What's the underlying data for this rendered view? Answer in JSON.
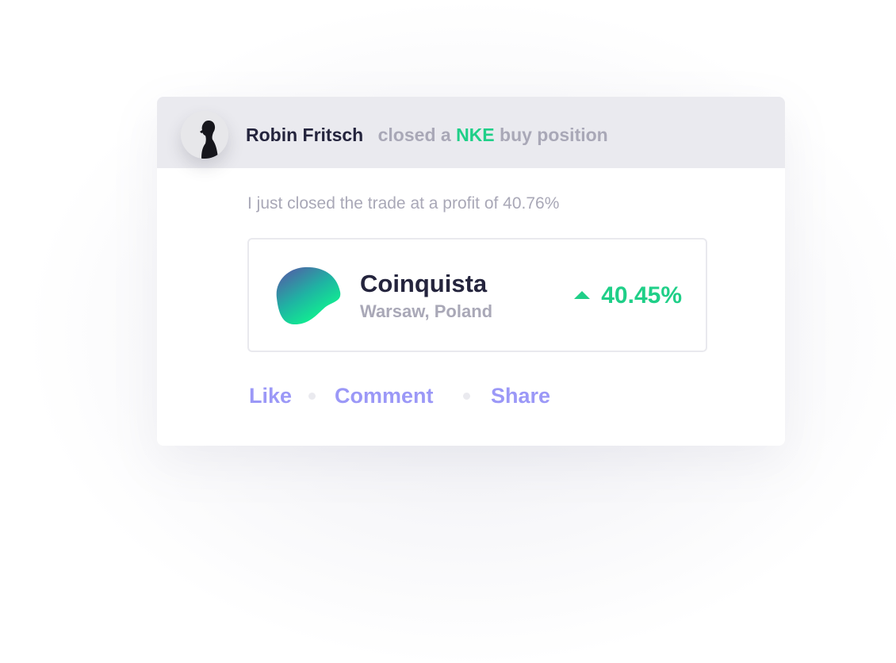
{
  "post": {
    "user_name": "Robin Fritsch",
    "action_prefix": "closed a",
    "ticker": "NKE",
    "action_suffix": "buy position",
    "message": "I just closed the trade at a profit of 40.76%"
  },
  "stock": {
    "name": "Coinquista",
    "location": "Warsaw, Poland",
    "change": "40.45%",
    "change_direction": "up",
    "logo_icon": "gradient-blob-logo"
  },
  "actions": {
    "like": "Like",
    "comment": "Comment",
    "share": "Share"
  },
  "colors": {
    "accent_green": "#1fcf88",
    "action_purple": "#9b98f7",
    "text_dark": "#24243d",
    "text_muted": "#a9a8b7",
    "header_bg": "#eaeaef"
  }
}
